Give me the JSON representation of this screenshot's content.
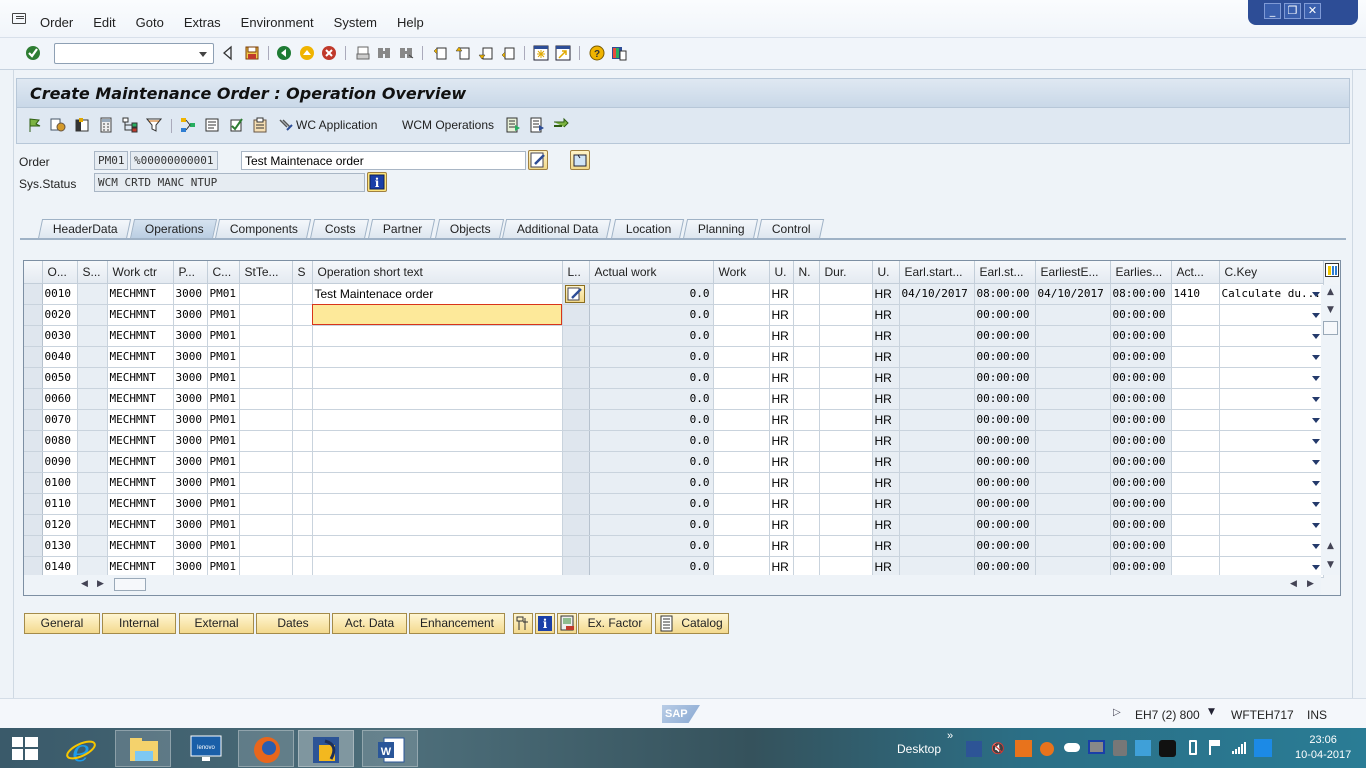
{
  "menubar": {
    "items": [
      "Order",
      "Edit",
      "Goto",
      "Extras",
      "Environment",
      "System",
      "Help"
    ]
  },
  "window_controls": {
    "minimize": "_",
    "restore": "❐",
    "close": "✕"
  },
  "toolbar": {
    "command_field_value": "",
    "icons": [
      "enter-icon",
      "back-arrow-icon",
      "save-icon",
      "back-icon",
      "exit-icon",
      "cancel-icon",
      "print-icon",
      "find-icon",
      "find-next-icon",
      "first-page-icon",
      "previous-page-icon",
      "next-page-icon",
      "last-page-icon",
      "create-session-icon",
      "shortcut-icon",
      "help-icon",
      "layout-menu-icon"
    ]
  },
  "page": {
    "title": "Create Maintenance Order : Operation Overview"
  },
  "app_toolbar": {
    "wc_application": "WC Application",
    "wcm_operations": "WCM Operations"
  },
  "header": {
    "order_label": "Order",
    "order_type": "PM01",
    "order_number": "%00000000001",
    "order_description": "Test Maintenace order",
    "sys_status_label": "Sys.Status",
    "sys_status_value": "WCM  CRTD MANC NTUP"
  },
  "tabs": [
    {
      "label": "HeaderData",
      "active": false
    },
    {
      "label": "Operations",
      "active": true
    },
    {
      "label": "Components",
      "active": false
    },
    {
      "label": "Costs",
      "active": false
    },
    {
      "label": "Partner",
      "active": false
    },
    {
      "label": "Objects",
      "active": false
    },
    {
      "label": "Additional Data",
      "active": false
    },
    {
      "label": "Location",
      "active": false
    },
    {
      "label": "Planning",
      "active": false
    },
    {
      "label": "Control",
      "active": false
    }
  ],
  "grid": {
    "columns": [
      "O...",
      "S...",
      "Work ctr",
      "P...",
      "C...",
      "StTe...",
      "S",
      "Operation short text",
      "L..",
      "Actual work",
      "Work",
      "U.",
      "N.",
      "Dur.",
      "U.",
      "Earl.start...",
      "Earl.st...",
      "EarliestE...",
      "Earlies...",
      "Act...",
      "C.Key"
    ],
    "rows": [
      {
        "op": "0010",
        "sub": "",
        "work_ctr": "MECHMNT",
        "plant": "3000",
        "ctrl": "PM01",
        "std_text": "",
        "s": "",
        "short_text": "Test Maintenace order",
        "actual_work": "0.0",
        "work": "",
        "unit1": "HR",
        "n": "",
        "dur": "",
        "unit2": "HR",
        "earl_start_date": "04/10/2017",
        "earl_start_time": "08:00:00",
        "earliest_end_date": "04/10/2017",
        "earliest_end_time": "08:00:00",
        "activity": "1410",
        "c_key": "Calculate du..."
      },
      {
        "op": "0020",
        "sub": "",
        "work_ctr": "MECHMNT",
        "plant": "3000",
        "ctrl": "PM01",
        "std_text": "",
        "s": "",
        "short_text": "",
        "actual_work": "0.0",
        "work": "",
        "unit1": "HR",
        "n": "",
        "dur": "",
        "unit2": "HR",
        "earl_start_date": "",
        "earl_start_time": "00:00:00",
        "earliest_end_date": "",
        "earliest_end_time": "00:00:00",
        "activity": "",
        "c_key": ""
      },
      {
        "op": "0030",
        "sub": "",
        "work_ctr": "MECHMNT",
        "plant": "3000",
        "ctrl": "PM01",
        "std_text": "",
        "s": "",
        "short_text": "",
        "actual_work": "0.0",
        "work": "",
        "unit1": "HR",
        "n": "",
        "dur": "",
        "unit2": "HR",
        "earl_start_date": "",
        "earl_start_time": "00:00:00",
        "earliest_end_date": "",
        "earliest_end_time": "00:00:00",
        "activity": "",
        "c_key": ""
      },
      {
        "op": "0040",
        "sub": "",
        "work_ctr": "MECHMNT",
        "plant": "3000",
        "ctrl": "PM01",
        "std_text": "",
        "s": "",
        "short_text": "",
        "actual_work": "0.0",
        "work": "",
        "unit1": "HR",
        "n": "",
        "dur": "",
        "unit2": "HR",
        "earl_start_date": "",
        "earl_start_time": "00:00:00",
        "earliest_end_date": "",
        "earliest_end_time": "00:00:00",
        "activity": "",
        "c_key": ""
      },
      {
        "op": "0050",
        "sub": "",
        "work_ctr": "MECHMNT",
        "plant": "3000",
        "ctrl": "PM01",
        "std_text": "",
        "s": "",
        "short_text": "",
        "actual_work": "0.0",
        "work": "",
        "unit1": "HR",
        "n": "",
        "dur": "",
        "unit2": "HR",
        "earl_start_date": "",
        "earl_start_time": "00:00:00",
        "earliest_end_date": "",
        "earliest_end_time": "00:00:00",
        "activity": "",
        "c_key": ""
      },
      {
        "op": "0060",
        "sub": "",
        "work_ctr": "MECHMNT",
        "plant": "3000",
        "ctrl": "PM01",
        "std_text": "",
        "s": "",
        "short_text": "",
        "actual_work": "0.0",
        "work": "",
        "unit1": "HR",
        "n": "",
        "dur": "",
        "unit2": "HR",
        "earl_start_date": "",
        "earl_start_time": "00:00:00",
        "earliest_end_date": "",
        "earliest_end_time": "00:00:00",
        "activity": "",
        "c_key": ""
      },
      {
        "op": "0070",
        "sub": "",
        "work_ctr": "MECHMNT",
        "plant": "3000",
        "ctrl": "PM01",
        "std_text": "",
        "s": "",
        "short_text": "",
        "actual_work": "0.0",
        "work": "",
        "unit1": "HR",
        "n": "",
        "dur": "",
        "unit2": "HR",
        "earl_start_date": "",
        "earl_start_time": "00:00:00",
        "earliest_end_date": "",
        "earliest_end_time": "00:00:00",
        "activity": "",
        "c_key": ""
      },
      {
        "op": "0080",
        "sub": "",
        "work_ctr": "MECHMNT",
        "plant": "3000",
        "ctrl": "PM01",
        "std_text": "",
        "s": "",
        "short_text": "",
        "actual_work": "0.0",
        "work": "",
        "unit1": "HR",
        "n": "",
        "dur": "",
        "unit2": "HR",
        "earl_start_date": "",
        "earl_start_time": "00:00:00",
        "earliest_end_date": "",
        "earliest_end_time": "00:00:00",
        "activity": "",
        "c_key": ""
      },
      {
        "op": "0090",
        "sub": "",
        "work_ctr": "MECHMNT",
        "plant": "3000",
        "ctrl": "PM01",
        "std_text": "",
        "s": "",
        "short_text": "",
        "actual_work": "0.0",
        "work": "",
        "unit1": "HR",
        "n": "",
        "dur": "",
        "unit2": "HR",
        "earl_start_date": "",
        "earl_start_time": "00:00:00",
        "earliest_end_date": "",
        "earliest_end_time": "00:00:00",
        "activity": "",
        "c_key": ""
      },
      {
        "op": "0100",
        "sub": "",
        "work_ctr": "MECHMNT",
        "plant": "3000",
        "ctrl": "PM01",
        "std_text": "",
        "s": "",
        "short_text": "",
        "actual_work": "0.0",
        "work": "",
        "unit1": "HR",
        "n": "",
        "dur": "",
        "unit2": "HR",
        "earl_start_date": "",
        "earl_start_time": "00:00:00",
        "earliest_end_date": "",
        "earliest_end_time": "00:00:00",
        "activity": "",
        "c_key": ""
      },
      {
        "op": "0110",
        "sub": "",
        "work_ctr": "MECHMNT",
        "plant": "3000",
        "ctrl": "PM01",
        "std_text": "",
        "s": "",
        "short_text": "",
        "actual_work": "0.0",
        "work": "",
        "unit1": "HR",
        "n": "",
        "dur": "",
        "unit2": "HR",
        "earl_start_date": "",
        "earl_start_time": "00:00:00",
        "earliest_end_date": "",
        "earliest_end_time": "00:00:00",
        "activity": "",
        "c_key": ""
      },
      {
        "op": "0120",
        "sub": "",
        "work_ctr": "MECHMNT",
        "plant": "3000",
        "ctrl": "PM01",
        "std_text": "",
        "s": "",
        "short_text": "",
        "actual_work": "0.0",
        "work": "",
        "unit1": "HR",
        "n": "",
        "dur": "",
        "unit2": "HR",
        "earl_start_date": "",
        "earl_start_time": "00:00:00",
        "earliest_end_date": "",
        "earliest_end_time": "00:00:00",
        "activity": "",
        "c_key": ""
      },
      {
        "op": "0130",
        "sub": "",
        "work_ctr": "MECHMNT",
        "plant": "3000",
        "ctrl": "PM01",
        "std_text": "",
        "s": "",
        "short_text": "",
        "actual_work": "0.0",
        "work": "",
        "unit1": "HR",
        "n": "",
        "dur": "",
        "unit2": "HR",
        "earl_start_date": "",
        "earl_start_time": "00:00:00",
        "earliest_end_date": "",
        "earliest_end_time": "00:00:00",
        "activity": "",
        "c_key": ""
      },
      {
        "op": "0140",
        "sub": "",
        "work_ctr": "MECHMNT",
        "plant": "3000",
        "ctrl": "PM01",
        "std_text": "",
        "s": "",
        "short_text": "",
        "actual_work": "0.0",
        "work": "",
        "unit1": "HR",
        "n": "",
        "dur": "",
        "unit2": "HR",
        "earl_start_date": "",
        "earl_start_time": "00:00:00",
        "earliest_end_date": "",
        "earliest_end_time": "00:00:00",
        "activity": "",
        "c_key": ""
      }
    ]
  },
  "bottom_buttons": {
    "general": "General",
    "internal": "Internal",
    "external": "External",
    "dates": "Dates",
    "act_data": "Act. Data",
    "enhancement": "Enhancement",
    "ex_factor": "Ex. Factor",
    "catalog": "Catalog"
  },
  "statusbar": {
    "logo": "SAP",
    "system": "EH7 (2) 800",
    "server": "WFTEH717",
    "mode": "INS"
  },
  "taskbar": {
    "desktop_label": "Desktop",
    "overflow": "»",
    "time": "23:06",
    "date": "10-04-2017"
  }
}
